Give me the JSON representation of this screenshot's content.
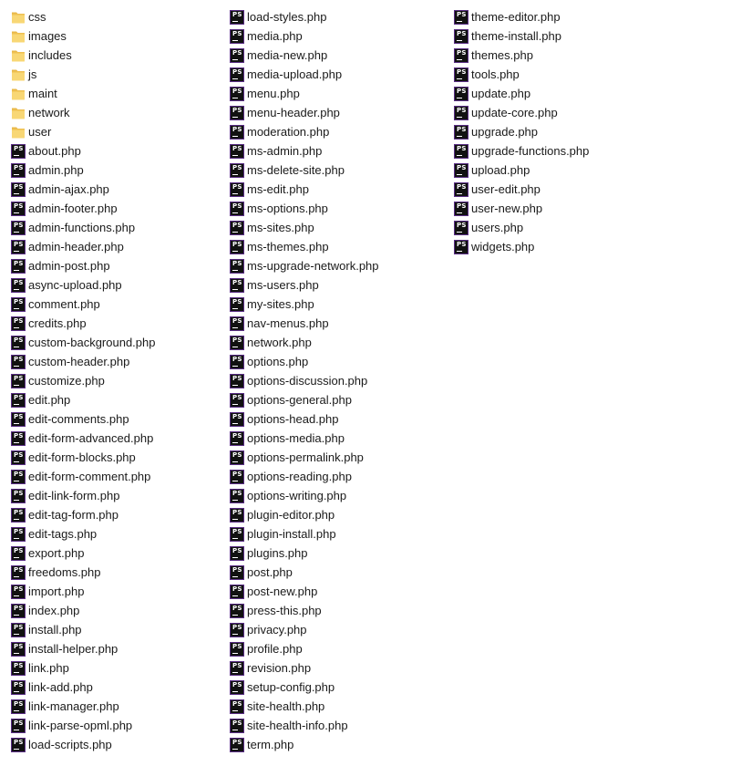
{
  "icons": {
    "folder": "folder-icon",
    "php": "phpstorm-file-icon"
  },
  "columns": [
    {
      "items": [
        {
          "name": "css",
          "type": "folder"
        },
        {
          "name": "images",
          "type": "folder"
        },
        {
          "name": "includes",
          "type": "folder"
        },
        {
          "name": "js",
          "type": "folder"
        },
        {
          "name": "maint",
          "type": "folder"
        },
        {
          "name": "network",
          "type": "folder"
        },
        {
          "name": "user",
          "type": "folder"
        },
        {
          "name": "about.php",
          "type": "php"
        },
        {
          "name": "admin.php",
          "type": "php"
        },
        {
          "name": "admin-ajax.php",
          "type": "php"
        },
        {
          "name": "admin-footer.php",
          "type": "php"
        },
        {
          "name": "admin-functions.php",
          "type": "php"
        },
        {
          "name": "admin-header.php",
          "type": "php"
        },
        {
          "name": "admin-post.php",
          "type": "php"
        },
        {
          "name": "async-upload.php",
          "type": "php"
        },
        {
          "name": "comment.php",
          "type": "php"
        },
        {
          "name": "credits.php",
          "type": "php"
        },
        {
          "name": "custom-background.php",
          "type": "php"
        },
        {
          "name": "custom-header.php",
          "type": "php"
        },
        {
          "name": "customize.php",
          "type": "php"
        },
        {
          "name": "edit.php",
          "type": "php"
        },
        {
          "name": "edit-comments.php",
          "type": "php"
        },
        {
          "name": "edit-form-advanced.php",
          "type": "php"
        },
        {
          "name": "edit-form-blocks.php",
          "type": "php"
        },
        {
          "name": "edit-form-comment.php",
          "type": "php"
        },
        {
          "name": "edit-link-form.php",
          "type": "php"
        },
        {
          "name": "edit-tag-form.php",
          "type": "php"
        },
        {
          "name": "edit-tags.php",
          "type": "php"
        },
        {
          "name": "export.php",
          "type": "php"
        },
        {
          "name": "freedoms.php",
          "type": "php"
        },
        {
          "name": "import.php",
          "type": "php"
        },
        {
          "name": "index.php",
          "type": "php"
        },
        {
          "name": "install.php",
          "type": "php"
        },
        {
          "name": "install-helper.php",
          "type": "php"
        },
        {
          "name": "link.php",
          "type": "php"
        },
        {
          "name": "link-add.php",
          "type": "php"
        },
        {
          "name": "link-manager.php",
          "type": "php"
        },
        {
          "name": "link-parse-opml.php",
          "type": "php"
        },
        {
          "name": "load-scripts.php",
          "type": "php"
        }
      ]
    },
    {
      "items": [
        {
          "name": "load-styles.php",
          "type": "php"
        },
        {
          "name": "media.php",
          "type": "php"
        },
        {
          "name": "media-new.php",
          "type": "php"
        },
        {
          "name": "media-upload.php",
          "type": "php"
        },
        {
          "name": "menu.php",
          "type": "php"
        },
        {
          "name": "menu-header.php",
          "type": "php"
        },
        {
          "name": "moderation.php",
          "type": "php"
        },
        {
          "name": "ms-admin.php",
          "type": "php"
        },
        {
          "name": "ms-delete-site.php",
          "type": "php"
        },
        {
          "name": "ms-edit.php",
          "type": "php"
        },
        {
          "name": "ms-options.php",
          "type": "php"
        },
        {
          "name": "ms-sites.php",
          "type": "php"
        },
        {
          "name": "ms-themes.php",
          "type": "php"
        },
        {
          "name": "ms-upgrade-network.php",
          "type": "php"
        },
        {
          "name": "ms-users.php",
          "type": "php"
        },
        {
          "name": "my-sites.php",
          "type": "php"
        },
        {
          "name": "nav-menus.php",
          "type": "php"
        },
        {
          "name": "network.php",
          "type": "php"
        },
        {
          "name": "options.php",
          "type": "php"
        },
        {
          "name": "options-discussion.php",
          "type": "php"
        },
        {
          "name": "options-general.php",
          "type": "php"
        },
        {
          "name": "options-head.php",
          "type": "php"
        },
        {
          "name": "options-media.php",
          "type": "php"
        },
        {
          "name": "options-permalink.php",
          "type": "php"
        },
        {
          "name": "options-reading.php",
          "type": "php"
        },
        {
          "name": "options-writing.php",
          "type": "php"
        },
        {
          "name": "plugin-editor.php",
          "type": "php"
        },
        {
          "name": "plugin-install.php",
          "type": "php"
        },
        {
          "name": "plugins.php",
          "type": "php"
        },
        {
          "name": "post.php",
          "type": "php"
        },
        {
          "name": "post-new.php",
          "type": "php"
        },
        {
          "name": "press-this.php",
          "type": "php"
        },
        {
          "name": "privacy.php",
          "type": "php"
        },
        {
          "name": "profile.php",
          "type": "php"
        },
        {
          "name": "revision.php",
          "type": "php"
        },
        {
          "name": "setup-config.php",
          "type": "php"
        },
        {
          "name": "site-health.php",
          "type": "php"
        },
        {
          "name": "site-health-info.php",
          "type": "php"
        },
        {
          "name": "term.php",
          "type": "php"
        }
      ]
    },
    {
      "items": [
        {
          "name": "theme-editor.php",
          "type": "php"
        },
        {
          "name": "theme-install.php",
          "type": "php"
        },
        {
          "name": "themes.php",
          "type": "php"
        },
        {
          "name": "tools.php",
          "type": "php"
        },
        {
          "name": "update.php",
          "type": "php"
        },
        {
          "name": "update-core.php",
          "type": "php"
        },
        {
          "name": "upgrade.php",
          "type": "php"
        },
        {
          "name": "upgrade-functions.php",
          "type": "php"
        },
        {
          "name": "upload.php",
          "type": "php"
        },
        {
          "name": "user-edit.php",
          "type": "php"
        },
        {
          "name": "user-new.php",
          "type": "php"
        },
        {
          "name": "users.php",
          "type": "php"
        },
        {
          "name": "widgets.php",
          "type": "php"
        }
      ]
    }
  ]
}
